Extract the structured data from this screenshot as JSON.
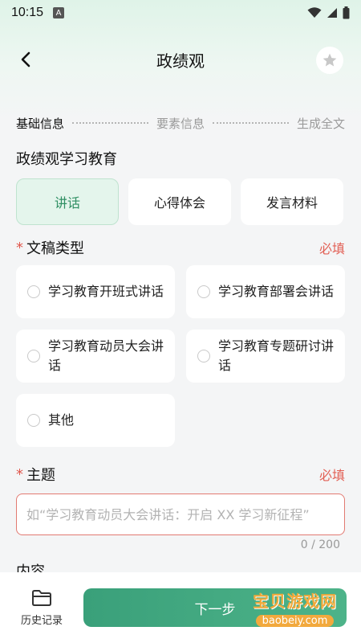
{
  "status": {
    "time": "10:15",
    "a_badge": "A"
  },
  "nav": {
    "title": "政绩观",
    "back_icon": "chevron-left-icon",
    "favorite_icon": "star-icon"
  },
  "steps": [
    {
      "label": "基础信息",
      "active": true
    },
    {
      "label": "要素信息",
      "active": false
    },
    {
      "label": "生成全文",
      "active": false
    }
  ],
  "section": {
    "title": "政绩观学习教育"
  },
  "tabs": [
    {
      "label": "讲话",
      "active": true
    },
    {
      "label": "心得体会",
      "active": false
    },
    {
      "label": "发言材料",
      "active": false
    }
  ],
  "doc_type": {
    "star": "*",
    "label": "文稿类型",
    "required": "必填",
    "options": [
      "学习教育开班式讲话",
      "学习教育部署会讲话",
      "学习教育动员大会讲话",
      "学习教育专题研讨讲话",
      "其他"
    ]
  },
  "topic": {
    "star": "*",
    "label": "主题",
    "required": "必填",
    "placeholder": "如“学习教育动员大会讲话：开启 XX 学习新征程”",
    "value": "",
    "counter": "0 / 200"
  },
  "content": {
    "label": "内容"
  },
  "bottom": {
    "history_label": "历史记录",
    "next_label": "下一步"
  },
  "watermark": {
    "title": "宝贝游戏网",
    "sub": "baobeiy.com"
  },
  "colors": {
    "accent": "#3aa07a",
    "required": "#e26055",
    "tab_active_bg": "#e4f5ec"
  }
}
